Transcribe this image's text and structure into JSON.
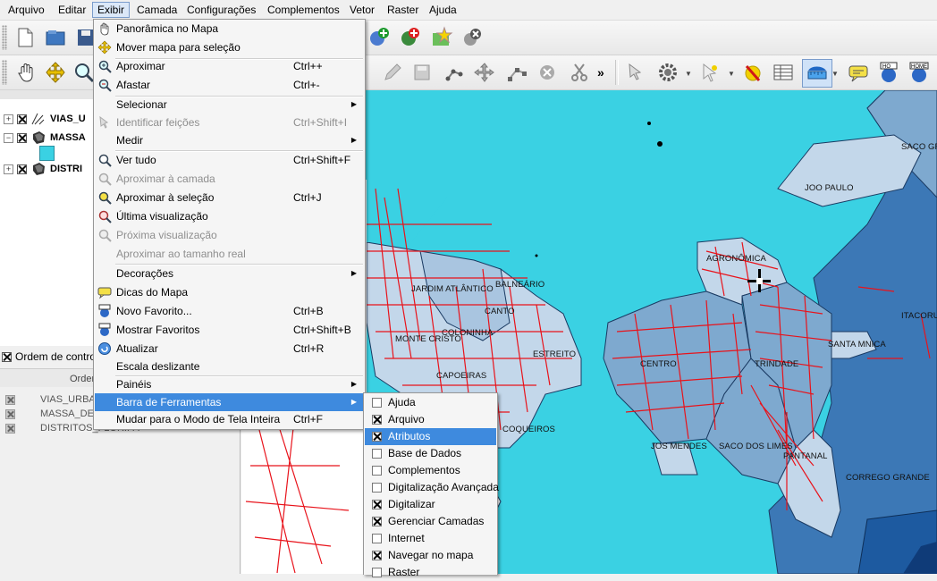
{
  "menubar": {
    "items": [
      {
        "label": "Arquivo"
      },
      {
        "label": "Editar"
      },
      {
        "label": "Exibir"
      },
      {
        "label": "Camada"
      },
      {
        "label": "Configurações"
      },
      {
        "label": "Complementos"
      },
      {
        "label": "Vetor"
      },
      {
        "label": "Raster"
      },
      {
        "label": "Ajuda"
      }
    ]
  },
  "layers": [
    {
      "name": "VIAS_U",
      "checked": true,
      "expanded": false
    },
    {
      "name": "MASSA",
      "checked": true,
      "expanded": true
    },
    {
      "name": "DISTRI",
      "checked": true,
      "expanded": false
    }
  ],
  "legend_swatch_color": "#3ad1e3",
  "order_control": {
    "label": "Ordem de controle",
    "checked": true
  },
  "order_panel": {
    "title": "Ordem",
    "items": [
      "VIAS_URBA",
      "MASSA_DE_",
      "DISTRITOS_FLORIPA"
    ]
  },
  "exibir_menu": {
    "entries": [
      {
        "label": "Panorâmica no Mapa",
        "shortcut": "",
        "icon": "pan-hand-icon",
        "disabled": false
      },
      {
        "label": "Mover mapa para seleção",
        "shortcut": "",
        "icon": "pan-to-selection-icon",
        "disabled": false
      },
      {
        "label": "Aproximar",
        "shortcut": "Ctrl++",
        "icon": "zoom-in-icon",
        "disabled": false
      },
      {
        "label": "Afastar",
        "shortcut": "Ctrl+-",
        "icon": "zoom-out-icon",
        "disabled": false
      },
      {
        "label": "Selecionar",
        "submenu": true
      },
      {
        "label": "Identificar feições",
        "shortcut": "Ctrl+Shift+I",
        "icon": "identify-icon",
        "disabled": true
      },
      {
        "label": "Medir",
        "submenu": true
      },
      {
        "label": "Ver tudo",
        "shortcut": "Ctrl+Shift+F",
        "icon": "zoom-full-icon",
        "disabled": false
      },
      {
        "label": "Aproximar à camada",
        "shortcut": "",
        "icon": "zoom-layer-icon",
        "disabled": true
      },
      {
        "label": "Aproximar à seleção",
        "shortcut": "Ctrl+J",
        "icon": "zoom-selection-icon",
        "disabled": false
      },
      {
        "label": "Última visualização",
        "shortcut": "",
        "icon": "zoom-last-icon",
        "disabled": false
      },
      {
        "label": "Próxima visualização",
        "shortcut": "",
        "icon": "zoom-next-icon",
        "disabled": true
      },
      {
        "label": "Aproximar ao tamanho real",
        "shortcut": "",
        "icon": "zoom-actual-icon",
        "disabled": true
      },
      {
        "label": "Decorações",
        "submenu": true
      },
      {
        "label": "Dicas do Mapa",
        "shortcut": "",
        "icon": "map-tips-icon",
        "disabled": false
      },
      {
        "label": "Novo Favorito...",
        "shortcut": "Ctrl+B",
        "icon": "new-bookmark-icon",
        "disabled": false
      },
      {
        "label": "Mostrar Favoritos",
        "shortcut": "Ctrl+Shift+B",
        "icon": "show-bookmarks-icon",
        "disabled": false
      },
      {
        "label": "Atualizar",
        "shortcut": "Ctrl+R",
        "icon": "refresh-icon",
        "disabled": false
      },
      {
        "label": "Escala deslizante",
        "shortcut": "",
        "icon": "",
        "disabled": false
      },
      {
        "label": "Painéis",
        "submenu": true
      },
      {
        "label": "Barra de Ferramentas",
        "submenu": true,
        "highlighted": true
      },
      {
        "label": "Mudar para o Modo de Tela Inteira",
        "shortcut": "Ctrl+F",
        "icon": "",
        "disabled": false
      }
    ]
  },
  "toolbars_submenu": {
    "entries": [
      {
        "label": "Ajuda",
        "checked": false
      },
      {
        "label": "Arquivo",
        "checked": true
      },
      {
        "label": "Atributos",
        "checked": true,
        "highlighted": true
      },
      {
        "label": "Base de Dados",
        "checked": false
      },
      {
        "label": "Complementos",
        "checked": false
      },
      {
        "label": "Digitalização Avançada",
        "checked": false
      },
      {
        "label": "Digitalizar",
        "checked": true
      },
      {
        "label": "Gerenciar Camadas",
        "checked": true
      },
      {
        "label": "Internet",
        "checked": false
      },
      {
        "label": "Navegar no mapa",
        "checked": true
      },
      {
        "label": "Raster",
        "checked": false
      }
    ]
  },
  "map": {
    "labels": [
      "JOO PAULO",
      "SACO GR",
      "AGRONÔMICA",
      "ITACORU",
      "JARDIM ATLÂNTICO",
      "BALNEÁRIO",
      "CANTO",
      "COLONINHA",
      "MONTE CRISTO",
      "ESTREITO",
      "CAPOEIRAS",
      "CENTRO",
      "TRINDADE",
      "SANTA MNICA",
      "JOS MENDES",
      "SACO DOS LIMES",
      "PANTANAL",
      "COQUEIROS",
      "CORREGO GRANDE"
    ]
  },
  "colors": {
    "sea": "#3ad1e3",
    "district_light": "#c3d7ea",
    "district_mid": "#7ea9cf",
    "district_dark": "#3c78b6",
    "district_darker": "#1d5aa0",
    "roads": "#e8131b",
    "highlight": "#3e8ade"
  }
}
